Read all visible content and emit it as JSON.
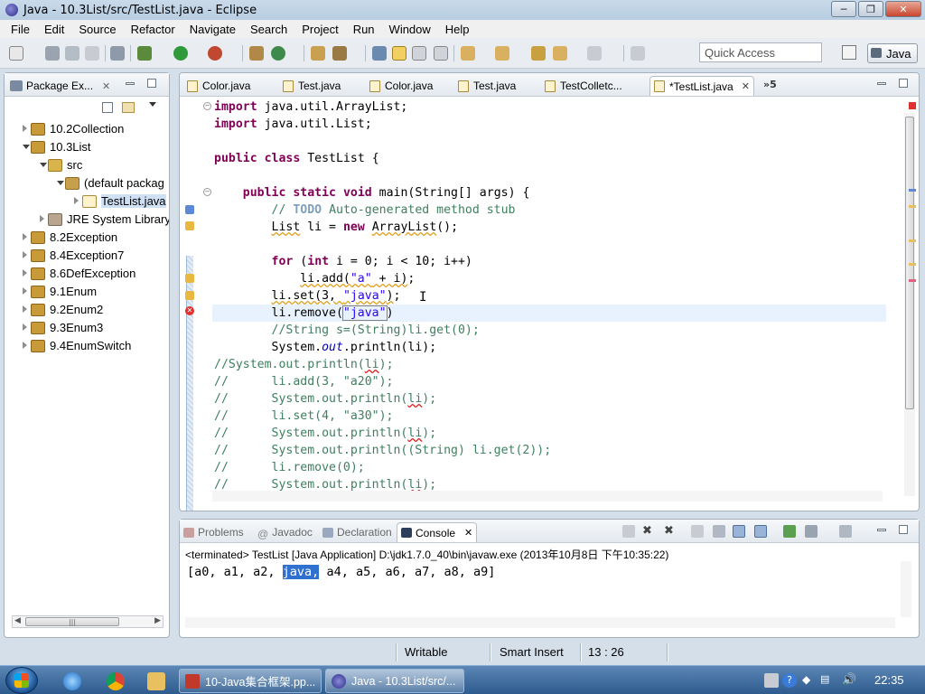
{
  "window": {
    "title": "Java - 10.3List/src/TestList.java - Eclipse",
    "minimize": "─",
    "maximize": "❐",
    "close": "✕"
  },
  "menu": [
    "File",
    "Edit",
    "Source",
    "Refactor",
    "Navigate",
    "Search",
    "Project",
    "Run",
    "Window",
    "Help"
  ],
  "toolbar": {
    "quick_access_placeholder": "Quick Access",
    "perspective_label": "Java"
  },
  "package_explorer": {
    "tab_label": "Package Ex...",
    "tree": [
      {
        "label": "10.2Collection",
        "depth": 0,
        "state": "collapsed",
        "icon": "project"
      },
      {
        "label": "10.3List",
        "depth": 0,
        "state": "expanded",
        "icon": "project"
      },
      {
        "label": "src",
        "depth": 1,
        "state": "expanded",
        "icon": "source-folder"
      },
      {
        "label": "(default packag",
        "depth": 2,
        "state": "expanded",
        "icon": "package"
      },
      {
        "label": "TestList.java",
        "depth": 3,
        "state": "collapsed",
        "icon": "java-file",
        "selected": true
      },
      {
        "label": "JRE System Library",
        "depth": 1,
        "state": "collapsed",
        "icon": "library"
      },
      {
        "label": "8.2Exception",
        "depth": 0,
        "state": "collapsed",
        "icon": "project"
      },
      {
        "label": "8.4Exception7",
        "depth": 0,
        "state": "collapsed",
        "icon": "project"
      },
      {
        "label": "8.6DefException",
        "depth": 0,
        "state": "collapsed",
        "icon": "project"
      },
      {
        "label": "9.1Enum",
        "depth": 0,
        "state": "collapsed",
        "icon": "project"
      },
      {
        "label": "9.2Enum2",
        "depth": 0,
        "state": "collapsed",
        "icon": "project"
      },
      {
        "label": "9.3Enum3",
        "depth": 0,
        "state": "collapsed",
        "icon": "project"
      },
      {
        "label": "9.4EnumSwitch",
        "depth": 0,
        "state": "collapsed",
        "icon": "project"
      }
    ],
    "scroll_thumb": "|||"
  },
  "editor": {
    "tabs": [
      {
        "label": "Color.java",
        "active": false
      },
      {
        "label": "Test.java",
        "active": false
      },
      {
        "label": "Color.java",
        "active": false
      },
      {
        "label": "Test.java",
        "active": false
      },
      {
        "label": "TestColletc...",
        "active": false
      },
      {
        "label": "*TestList.java",
        "active": true
      }
    ],
    "overflow_label": "»5",
    "close_glyph": "✕"
  },
  "console": {
    "tabs": [
      {
        "label": "Problems",
        "active": false
      },
      {
        "label": "Javadoc",
        "active": false
      },
      {
        "label": "Declaration",
        "active": false
      },
      {
        "label": "Console",
        "active": true
      }
    ],
    "terminated_line": "<terminated> TestList [Java Application] D:\\jdk1.7.0_40\\bin\\javaw.exe (2013年10月8日 下午10:35:22)",
    "output_before": "[a0, a1, a2, ",
    "output_highlight": "java,",
    "output_after": " a4, a5, a6, a7, a8, a9]"
  },
  "status": {
    "writable": "Writable",
    "insert_mode": "Smart Insert",
    "position": "13 : 26"
  },
  "taskbar": {
    "tasks": [
      {
        "label": "10-Java集合框架.pp..."
      },
      {
        "label": "Java - 10.3List/src/..."
      }
    ],
    "clock": "22:35"
  },
  "colors": {
    "keyword": "#7f0055",
    "comment": "#3f7f5f",
    "string": "#2a00ff",
    "error": "#e02020"
  }
}
